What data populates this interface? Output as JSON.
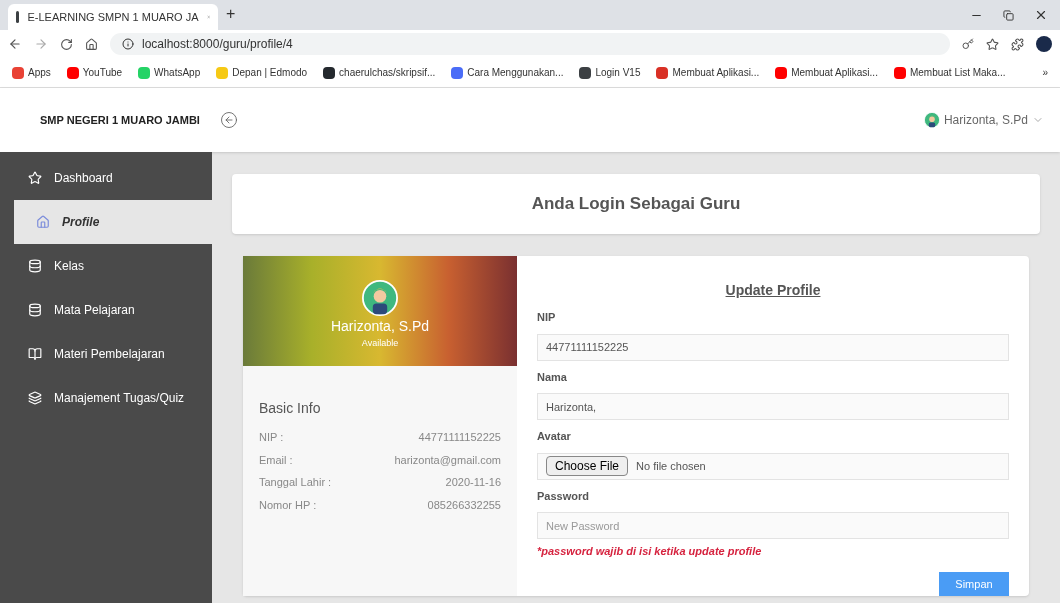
{
  "browser": {
    "tab_title": "E-LEARNING SMPN 1 MUARO JA",
    "new_tab": "+",
    "url": "localhost:8000/guru/profile/4",
    "bookmarks": [
      {
        "label": "Apps",
        "color": "#e94235"
      },
      {
        "label": "YouTube",
        "color": "#ff0000"
      },
      {
        "label": "WhatsApp",
        "color": "#25d366"
      },
      {
        "label": "Depan | Edmodo",
        "color": "#f6c915"
      },
      {
        "label": "chaerulchas/skripsif...",
        "color": "#24292e"
      },
      {
        "label": "Cara Menggunakan...",
        "color": "#4a6cf7"
      },
      {
        "label": "Login V15",
        "color": "#3c4043"
      },
      {
        "label": "Membuat Aplikasi...",
        "color": "#d93025"
      },
      {
        "label": "Membuat Aplikasi...",
        "color": "#ff0000"
      },
      {
        "label": "Membuat List Maka...",
        "color": "#ff0000"
      }
    ],
    "more": "»"
  },
  "header": {
    "brand": "SMP NEGERI 1 MUARO JAMBI",
    "user": "Harizonta, S.Pd"
  },
  "sidebar": [
    {
      "label": "Dashboard",
      "selected": false
    },
    {
      "label": "Profile",
      "selected": true
    },
    {
      "label": "Kelas",
      "selected": false
    },
    {
      "label": "Mata Pelajaran",
      "selected": false
    },
    {
      "label": "Materi Pembelajaran",
      "selected": false
    },
    {
      "label": "Manajement Tugas/Quiz",
      "selected": false
    }
  ],
  "banner": "Anda Login Sebagai Guru",
  "profile_card": {
    "name": "Harizonta, S.Pd",
    "status": "Available",
    "info_title": "Basic Info",
    "info": [
      {
        "label": "NIP :",
        "value": "44771111152225"
      },
      {
        "label": "Email :",
        "value": "harizonta@gmail.com"
      },
      {
        "label": "Tanggal Lahir :",
        "value": "2020-11-16"
      },
      {
        "label": "Nomor HP :",
        "value": "085266332255"
      }
    ]
  },
  "form": {
    "title": "Update Profile",
    "fields": [
      {
        "kind": "text",
        "label": "NIP",
        "value": "44771111152225"
      },
      {
        "kind": "text",
        "label": "Nama",
        "value": "Harizonta,"
      },
      {
        "kind": "file",
        "label": "Avatar",
        "button": "Choose File",
        "value": "No file chosen"
      },
      {
        "kind": "password",
        "label": "Password",
        "placeholder": "New Password"
      }
    ],
    "note": "*password wajib di isi ketika update profile",
    "submit": "Simpan"
  }
}
